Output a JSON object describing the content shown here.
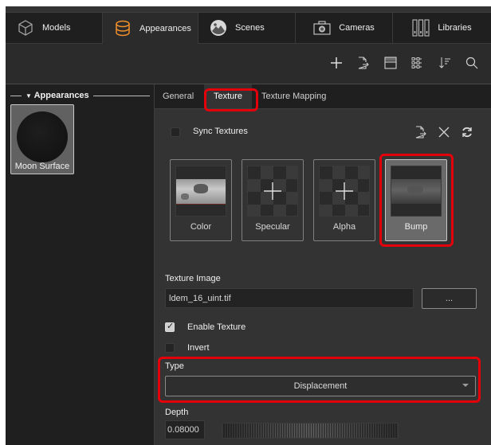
{
  "main_tabs": [
    {
      "label": "Models",
      "icon": "cube-icon",
      "active": false
    },
    {
      "label": "Appearances",
      "icon": "appearance-cylinder-icon",
      "active": true
    },
    {
      "label": "Scenes",
      "icon": "scene-landscape-icon",
      "active": false
    },
    {
      "label": "Cameras",
      "icon": "camera-icon",
      "active": false
    },
    {
      "label": "Libraries",
      "icon": "libraries-icon",
      "active": false
    }
  ],
  "toolbar": {
    "icons": [
      "add-icon",
      "export-icon",
      "panel-layout-icon",
      "grid-view-icon",
      "sort-icon",
      "search-icon"
    ]
  },
  "left_panel": {
    "section_title": "Appearances",
    "items": [
      {
        "label": "Moon Surface",
        "selected": true
      }
    ]
  },
  "sub_tabs": [
    {
      "label": "General",
      "active": false
    },
    {
      "label": "Texture",
      "active": true
    },
    {
      "label": "Texture Mapping",
      "active": false
    }
  ],
  "texture": {
    "sync_textures": {
      "label": "Sync Textures",
      "checked": false
    },
    "actions": [
      "export-icon",
      "close-icon",
      "refresh-icon"
    ],
    "slots": [
      {
        "label": "Color",
        "has_image": true,
        "selected": false
      },
      {
        "label": "Specular",
        "has_image": false,
        "selected": false
      },
      {
        "label": "Alpha",
        "has_image": false,
        "selected": false
      },
      {
        "label": "Bump",
        "has_image": true,
        "selected": true
      }
    ],
    "texture_image": {
      "label": "Texture Image",
      "value": "ldem_16_uint.tif",
      "browse_label": "..."
    },
    "enable_texture": {
      "label": "Enable Texture",
      "checked": true
    },
    "invert": {
      "label": "Invert",
      "checked": false
    },
    "type": {
      "label": "Type",
      "value": "Displacement"
    },
    "depth": {
      "label": "Depth",
      "value": "0.08000"
    }
  },
  "highlight_color": "#e4000b",
  "accent_color": "#f0902a"
}
